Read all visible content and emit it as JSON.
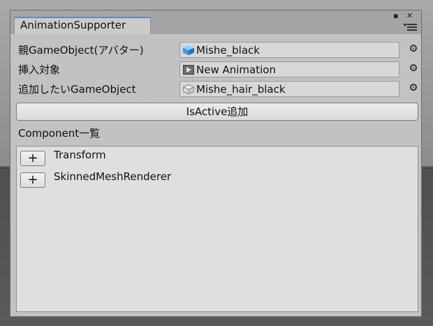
{
  "window": {
    "tab_title": "AnimationSupporter",
    "maximize_glyph": "▪",
    "close_glyph": "✕"
  },
  "fields": [
    {
      "label": "親GameObject(アバター)",
      "value": "Mishe_black",
      "icon": "prefab-cube-blue-icon"
    },
    {
      "label": "挿入対象",
      "value": "New Animation",
      "icon": "animation-clip-icon"
    },
    {
      "label": "追加したいGameObject",
      "value": "Mishe_hair_black",
      "icon": "gameobject-cube-gray-icon"
    }
  ],
  "add_button_label": "IsActive追加",
  "component_section": {
    "title": "Component一覧",
    "items": [
      {
        "button": "+",
        "label": "Transform"
      },
      {
        "button": "+",
        "label": "SkinnedMeshRenderer"
      }
    ]
  },
  "colors": {
    "accent": "#4f8ed6",
    "window_bg": "#c2c2c2",
    "tabbar_bg": "#a5a5a5"
  }
}
